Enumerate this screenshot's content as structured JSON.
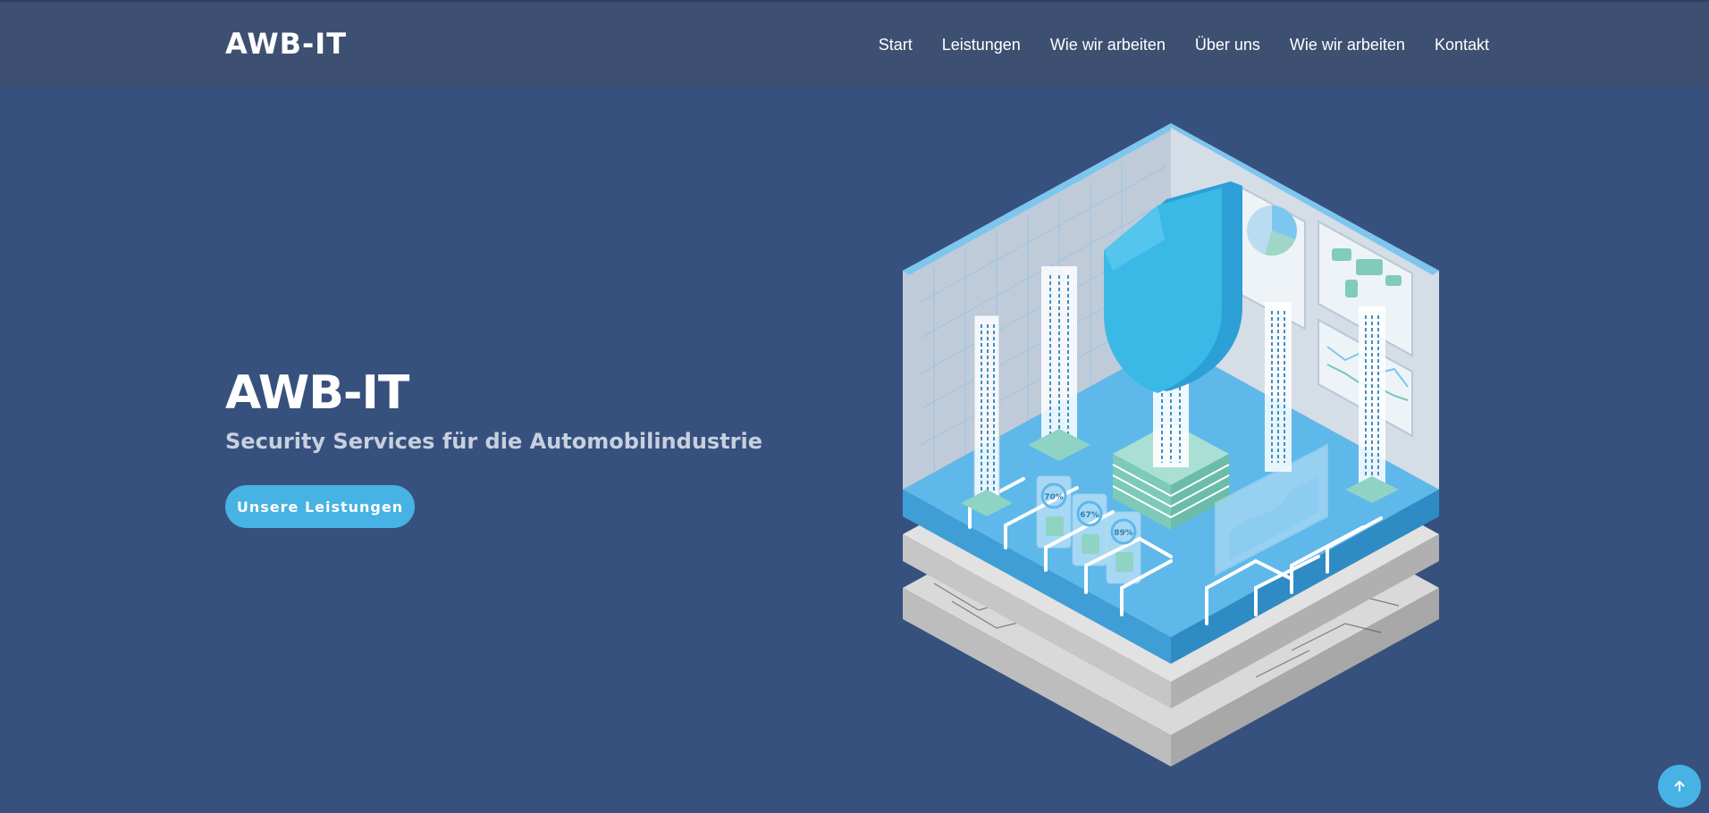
{
  "header": {
    "logo": "AWB-IT",
    "nav": [
      {
        "label": "Start"
      },
      {
        "label": "Leistungen"
      },
      {
        "label": "Wie wir arbeiten"
      },
      {
        "label": "Über uns"
      },
      {
        "label": "Wie wir arbeiten"
      },
      {
        "label": "Kontakt"
      }
    ]
  },
  "hero": {
    "title": "AWB-IT",
    "subtitle": "Security Services für die Automobilindustrie",
    "cta_label": "Unsere Leistungen"
  },
  "illustration": {
    "badges": [
      "70%",
      "67%",
      "89%"
    ]
  },
  "colors": {
    "background": "#37517e",
    "header": "#3e5071",
    "accent": "#47b2e4",
    "subtitle": "#c7d0de"
  },
  "icons": {
    "scroll_top": "arrow-up-icon"
  }
}
